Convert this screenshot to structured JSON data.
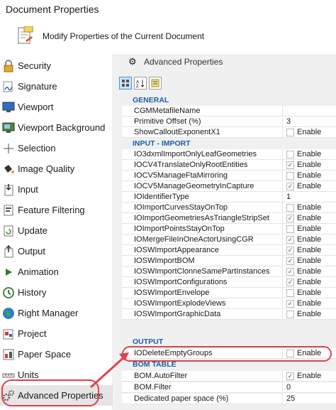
{
  "window": {
    "title": "Document Properties"
  },
  "header": {
    "text": "Modify Properties of the Current Document",
    "icon": "document-properties-icon"
  },
  "sidebar": {
    "items": [
      {
        "label": "Security",
        "icon": "lock-icon"
      },
      {
        "label": "Signature",
        "icon": "signature-icon"
      },
      {
        "label": "Viewport",
        "icon": "monitor-icon"
      },
      {
        "label": "Viewport Background",
        "icon": "monitor-background-icon"
      },
      {
        "label": "Selection",
        "icon": "crosshair-icon"
      },
      {
        "label": "Image Quality",
        "icon": "paint-bucket-icon"
      },
      {
        "label": "Input",
        "icon": "input-icon"
      },
      {
        "label": "Feature Filtering",
        "icon": "filter-icon"
      },
      {
        "label": "Update",
        "icon": "update-icon"
      },
      {
        "label": "Output",
        "icon": "output-icon"
      },
      {
        "label": "Animation",
        "icon": "play-icon"
      },
      {
        "label": "History",
        "icon": "history-icon"
      },
      {
        "label": "Right Manager",
        "icon": "globe-icon"
      },
      {
        "label": "Project",
        "icon": "project-icon"
      },
      {
        "label": "Paper Space",
        "icon": "paper-space-icon"
      },
      {
        "label": "Units",
        "icon": "ruler-icon"
      },
      {
        "label": "Advanced Properties",
        "icon": "gears-icon"
      }
    ],
    "selected": "Advanced Properties"
  },
  "panel": {
    "title": "Advanced Properties",
    "icon": "gears-icon"
  },
  "toolbar": {
    "buttons": [
      {
        "icon": "categorized-icon"
      },
      {
        "icon": "sort-alphabetical-icon"
      },
      {
        "icon": "property-pages-icon"
      }
    ]
  },
  "grid": {
    "categories": {
      "general": "GENERAL",
      "input_import": "INPUT - IMPORT",
      "output": "OUTPUT",
      "bom_table": "BOM TABLE"
    },
    "checkbox_label": "Enable",
    "general": [
      {
        "name": "CGMMetafileName",
        "value": ""
      },
      {
        "name": "Primitive Offset (%)",
        "value": "3"
      },
      {
        "name": "ShowCalloutExponentX1",
        "checkbox": "unchecked"
      }
    ],
    "input_import": [
      {
        "name": "IO3dxmlImportOnlyLeafGeometries",
        "checkbox": "unchecked"
      },
      {
        "name": "IOCV4TranslateOnlyRootEntities",
        "checkbox": "checked"
      },
      {
        "name": "IOCV5ManageFtaMirroring",
        "checkbox": "unchecked"
      },
      {
        "name": "IOCV5ManageGeometryInCapture",
        "checkbox": "checked"
      },
      {
        "name": "IOIdentifierType",
        "value": "1"
      },
      {
        "name": "IOImportCurvesStayOnTop",
        "checkbox": "unchecked"
      },
      {
        "name": "IOImportGeometriesAsTriangleStripSet",
        "checkbox": "checked"
      },
      {
        "name": "IOImportPointsStayOnTop",
        "checkbox": "unchecked"
      },
      {
        "name": "IOMergeFileInOneActorUsingCGR",
        "checkbox": "checked"
      },
      {
        "name": "IOSWImportAppearance",
        "checkbox": "checked"
      },
      {
        "name": "IOSWImportBOM",
        "checkbox": "checked"
      },
      {
        "name": "IOSWImportClonneSamePartInstances",
        "checkbox": "checked"
      },
      {
        "name": "IOSWImportConfigurations",
        "checkbox": "checked"
      },
      {
        "name": "IOSWImportEnvelope",
        "checkbox": "unchecked"
      },
      {
        "name": "IOSWImportExplodeViews",
        "checkbox": "checked"
      },
      {
        "name": "IOSWImportGraphicData",
        "checkbox": "unchecked"
      }
    ],
    "output": [
      {
        "name": "IODeleteEmptyGroups",
        "checkbox": "unchecked"
      }
    ],
    "bom_table": [
      {
        "name": "BOM.AutoFilter",
        "checkbox": "checked"
      },
      {
        "name": "BOM.Filter",
        "value": "0"
      },
      {
        "name": "Dedicated paper space (%)",
        "value": "25"
      }
    ]
  },
  "accent_color": "#e0424a"
}
